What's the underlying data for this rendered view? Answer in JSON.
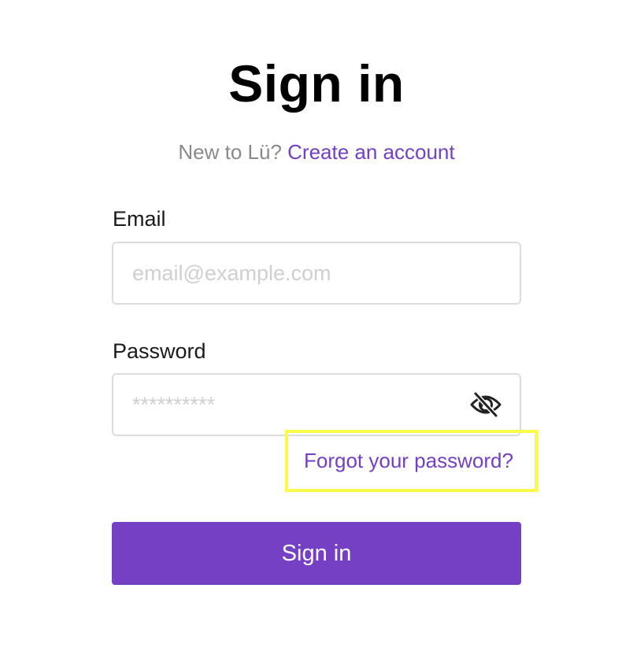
{
  "app_name": "Lü",
  "header": {
    "title": "Sign in",
    "new_user_prompt": "New to Lü?",
    "create_account_link": "Create an account"
  },
  "form": {
    "email": {
      "label": "Email",
      "value": "",
      "placeholder": "email@example.com"
    },
    "password": {
      "label": "Password",
      "value": "",
      "placeholder": "**********",
      "visibility_icon": "eye-off-icon"
    },
    "forgot_password_link": "Forgot your password?",
    "submit_label": "Sign in"
  },
  "colors": {
    "accent": "#7540c4",
    "link": "#7340c4",
    "highlight": "#fafa49",
    "muted_text": "#8a8a8a",
    "input_border": "#dcdcdc"
  }
}
